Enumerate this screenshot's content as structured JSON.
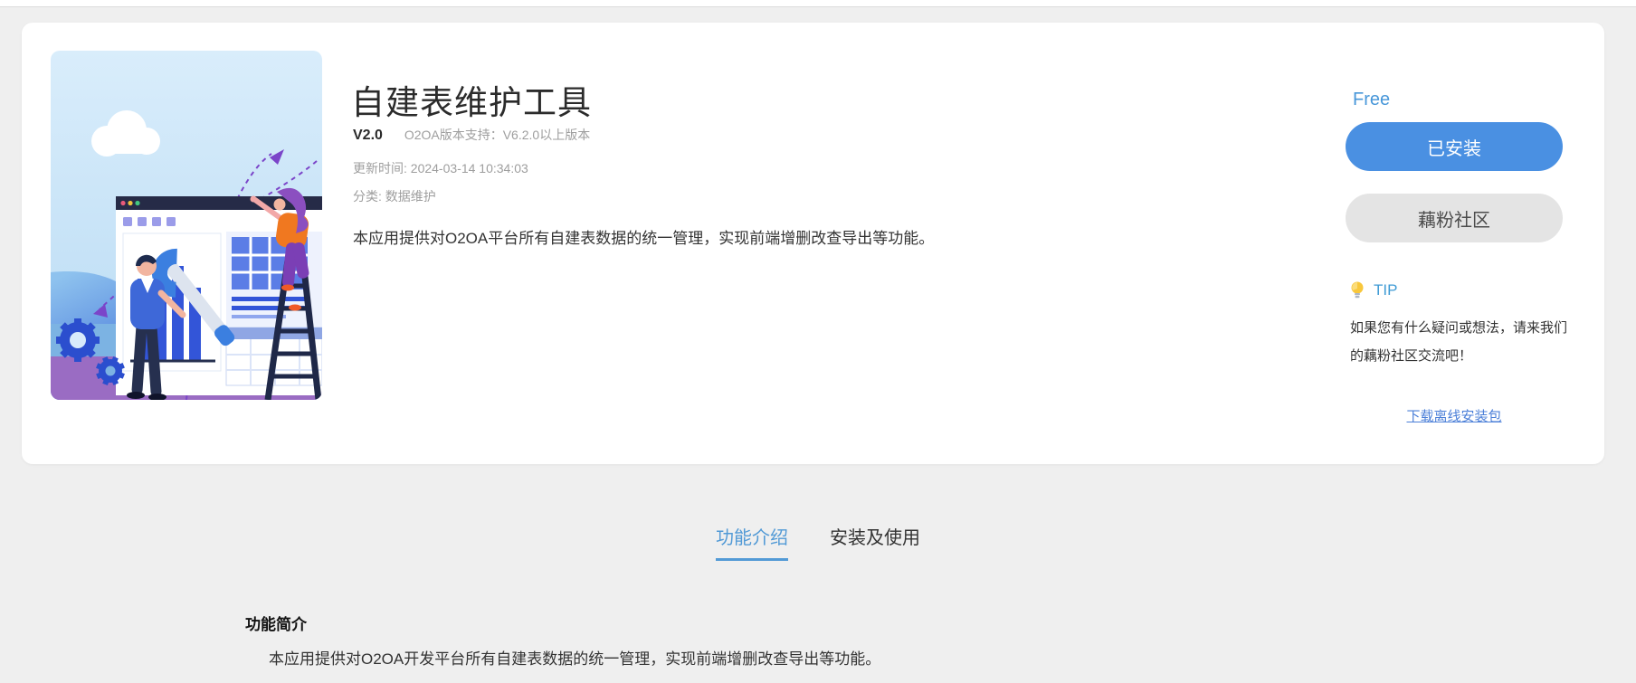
{
  "app_card": {
    "title": "自建表维护工具",
    "version": "V2.0",
    "platform_support": "O2OA版本支持：V6.2.0以上版本",
    "updated_at": "更新时间: 2024-03-14 10:34:03",
    "category": "分类: 数据维护",
    "description": "本应用提供对O2OA平台所有自建表数据的统一管理，实现前端增删改查导出等功能。",
    "illustration": "app-cover-illustration"
  },
  "purchase_panel": {
    "price_label": "Free",
    "installed_button_label": "已安装",
    "community_button_label": "藕粉社区",
    "tip_icon": "lightbulb-icon",
    "tip_title": "TIP",
    "tip_text": "如果您有什么疑问或想法，请来我们的藕粉社区交流吧！",
    "download_link_label": "下载离线安装包"
  },
  "tabs": [
    {
      "label": "功能介绍",
      "active": true
    },
    {
      "label": "安装及使用",
      "active": false
    }
  ],
  "content_section": {
    "heading": "功能简介",
    "body": "本应用提供对O2OA开发平台所有自建表数据的统一管理，实现前端增删改查导出等功能。"
  },
  "colors": {
    "page_background": "#efefef",
    "accent_blue": "#4a90e2",
    "free_blue": "#4897d9",
    "tip_blue": "#3f9bd5",
    "link_blue": "#4b7fd8",
    "tab_active_blue": "#529ad6",
    "community_gray": "#e4e4e4"
  }
}
